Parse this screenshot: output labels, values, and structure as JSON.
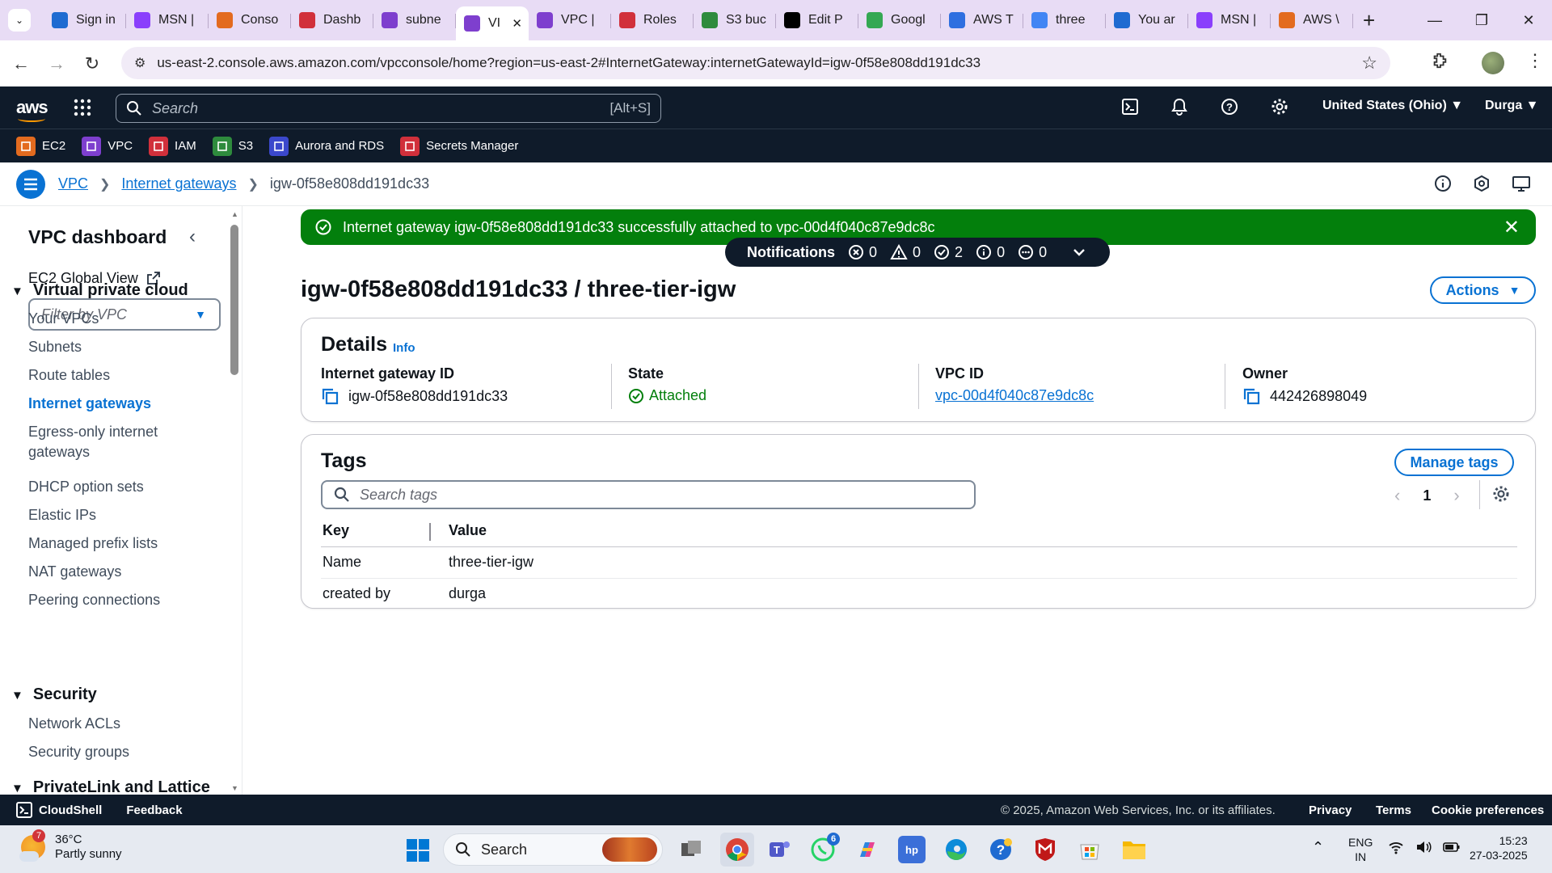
{
  "browser": {
    "tabs": [
      {
        "title": "Sign in",
        "icon": "s-icon",
        "color": "#1f6bd1"
      },
      {
        "title": "MSN |",
        "icon": "msn-butterfly-icon",
        "color": "#8a3ffc"
      },
      {
        "title": "Conso",
        "icon": "aws-orange-icon",
        "color": "#e36b1f"
      },
      {
        "title": "Dashb",
        "icon": "aws-red-icon",
        "color": "#d1303b"
      },
      {
        "title": "subne",
        "icon": "vpc-purple-icon",
        "color": "#7e3fce"
      },
      {
        "title": "VI",
        "icon": "vpc-purple-icon",
        "color": "#7e3fce",
        "active": true
      },
      {
        "title": "VPC |",
        "icon": "vpc-purple-icon",
        "color": "#7e3fce"
      },
      {
        "title": "Roles",
        "icon": "iam-red-icon",
        "color": "#d1303b"
      },
      {
        "title": "S3 buc",
        "icon": "s3-green-icon",
        "color": "#2e8b3d"
      },
      {
        "title": "Edit P",
        "icon": "dev-icon",
        "color": "#000000"
      },
      {
        "title": "Googl",
        "icon": "meet-icon",
        "color": "#34a853"
      },
      {
        "title": "AWS T",
        "icon": "blue-dot-icon",
        "color": "#2f6fe0"
      },
      {
        "title": "three",
        "icon": "google-icon",
        "color": "#4285f4"
      },
      {
        "title": "You ar",
        "icon": "s-icon",
        "color": "#1f6bd1"
      },
      {
        "title": "MSN |",
        "icon": "msn-butterfly-icon",
        "color": "#8a3ffc"
      },
      {
        "title": "AWS \\",
        "icon": "aws-cube-icon",
        "color": "#e36b1f"
      }
    ],
    "url": "us-east-2.console.aws.amazon.com/vpcconsole/home?region=us-east-2#InternetGateway:internetGatewayId=igw-0f58e808dd191dc33"
  },
  "aws_header": {
    "logo": "aws",
    "search_placeholder": "Search",
    "search_shortcut": "[Alt+S]",
    "region": "United States (Ohio) ▼",
    "user": "Durga ▼"
  },
  "favorites": [
    {
      "label": "EC2",
      "color": "#e36b1f"
    },
    {
      "label": "VPC",
      "color": "#7e3fce"
    },
    {
      "label": "IAM",
      "color": "#d1303b"
    },
    {
      "label": "S3",
      "color": "#2e8b3d"
    },
    {
      "label": "Aurora and RDS",
      "color": "#3b48cc"
    },
    {
      "label": "Secrets Manager",
      "color": "#d1303b"
    }
  ],
  "breadcrumb": {
    "vpc": "VPC",
    "internet_gateways": "Internet gateways",
    "current": "igw-0f58e808dd191dc33"
  },
  "sidenav": {
    "title": "VPC dashboard",
    "ec2_global": "EC2 Global View",
    "filter_placeholder": "Filter by VPC",
    "sections": {
      "vpc": "Virtual private cloud",
      "security": "Security",
      "privatelink": "PrivateLink and Lattice"
    },
    "vpc_items": [
      "Your VPCs",
      "Subnets",
      "Route tables",
      "Internet gateways",
      "Egress-only internet gateways",
      "DHCP option sets",
      "Elastic IPs",
      "Managed prefix lists",
      "NAT gateways",
      "Peering connections"
    ],
    "security_items": [
      "Network ACLs",
      "Security groups"
    ]
  },
  "flash": {
    "message": "Internet gateway igw-0f58e808dd191dc33 successfully attached to vpc-00d4f040c87e9dc8c",
    "color": "#037f0c"
  },
  "notifications": {
    "label": "Notifications",
    "errors": "0",
    "warnings": "0",
    "success": "2",
    "info": "0",
    "in_progress": "0"
  },
  "page": {
    "title": "igw-0f58e808dd191dc33 / three-tier-igw",
    "actions": "Actions"
  },
  "details": {
    "title": "Details",
    "info": "Info",
    "igw_label": "Internet gateway ID",
    "igw_value": "igw-0f58e808dd191dc33",
    "state_label": "State",
    "state_value": "Attached",
    "vpc_label": "VPC ID",
    "vpc_value": "vpc-00d4f040c87e9dc8c",
    "owner_label": "Owner",
    "owner_value": "442426898049"
  },
  "tags": {
    "title": "Tags",
    "manage": "Manage tags",
    "search_placeholder": "Search tags",
    "page": "1",
    "col_key": "Key",
    "col_value": "Value",
    "rows": [
      {
        "key": "Name",
        "value": "three-tier-igw"
      },
      {
        "key": "created by",
        "value": "durga"
      }
    ]
  },
  "footer": {
    "cloudshell": "CloudShell",
    "feedback": "Feedback",
    "copyright": "© 2025, Amazon Web Services, Inc. or its affiliates.",
    "privacy": "Privacy",
    "terms": "Terms",
    "cookie": "Cookie preferences"
  },
  "taskbar": {
    "temperature": "36°C",
    "weather": "Partly sunny",
    "weather_badge": "7",
    "search": "Search",
    "whatsapp_badge": "6",
    "lang1": "ENG",
    "lang2": "IN",
    "time": "15:23",
    "date": "27-03-2025"
  }
}
